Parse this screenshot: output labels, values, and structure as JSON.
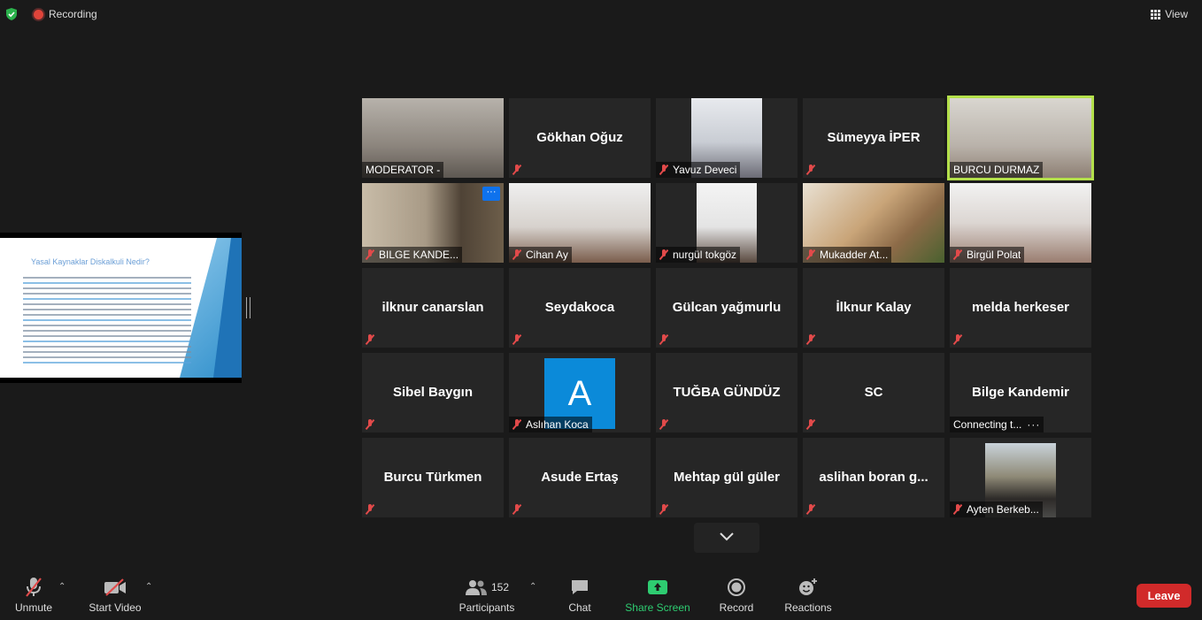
{
  "topbar": {
    "recording_label": "Recording",
    "view_label": "View"
  },
  "shared_slide": {
    "title": "Yasal Kaynaklar Diskalkuli Nedir?"
  },
  "tiles": [
    {
      "name": "",
      "label": "MODERATOR -",
      "video": true
    },
    {
      "name": "Gökhan Oğuz",
      "label": "",
      "video": false
    },
    {
      "name": "",
      "label": "Yavuz Deveci",
      "video": true
    },
    {
      "name": "Sümeyya İPER",
      "label": "",
      "video": false
    },
    {
      "name": "",
      "label": "BURCU DURMAZ",
      "video": true
    },
    {
      "name": "",
      "label": "BILGE KANDE...",
      "video": true
    },
    {
      "name": "",
      "label": "Cihan Ay",
      "video": true
    },
    {
      "name": "",
      "label": "nurgül tokgöz",
      "video": true
    },
    {
      "name": "",
      "label": "Mukadder At...",
      "video": true
    },
    {
      "name": "",
      "label": "Birgül Polat",
      "video": true
    },
    {
      "name": "ilknur canarslan",
      "label": "",
      "video": false
    },
    {
      "name": "Seydakoca",
      "label": "",
      "video": false
    },
    {
      "name": "Gülcan yağmurlu",
      "label": "",
      "video": false
    },
    {
      "name": "İlknur Kalay",
      "label": "",
      "video": false
    },
    {
      "name": "melda herkeser",
      "label": "",
      "video": false
    },
    {
      "name": "Sibel Baygın",
      "label": "",
      "video": false
    },
    {
      "name": "",
      "label": "Aslıhan Koca",
      "avatar_letter": "A"
    },
    {
      "name": "TUĞBA GÜNDÜZ",
      "label": "",
      "video": false
    },
    {
      "name": "SC",
      "label": "",
      "video": false
    },
    {
      "name": "Bilge Kandemir",
      "label": "Connecting t...",
      "video": false
    },
    {
      "name": "Burcu Türkmen",
      "label": "",
      "video": false
    },
    {
      "name": "Asude Ertaş",
      "label": "",
      "video": false
    },
    {
      "name": "Mehtap gül güler",
      "label": "",
      "video": false
    },
    {
      "name": "aslihan  boran  g...",
      "label": "",
      "video": false
    },
    {
      "name": "",
      "label": "Ayten Berkeb...",
      "video": true
    }
  ],
  "toolbar": {
    "unmute": "Unmute",
    "start_video": "Start Video",
    "participants": "Participants",
    "participants_count": "152",
    "chat": "Chat",
    "share_screen": "Share Screen",
    "record": "Record",
    "reactions": "Reactions",
    "leave": "Leave"
  },
  "colors": {
    "speaking_border": "#b4e04b",
    "leave": "#d12a2a",
    "share_screen": "#2ecc71",
    "mic_off": "#e24a4a",
    "avatar": "#0b8ad9"
  },
  "icons": [
    "shield-icon",
    "record-dot-icon",
    "grid-view-icon",
    "mic-off-icon",
    "video-off-icon",
    "participants-icon",
    "chat-icon",
    "share-screen-icon",
    "record-icon",
    "reactions-icon",
    "chevron-down-icon",
    "more-icon"
  ]
}
